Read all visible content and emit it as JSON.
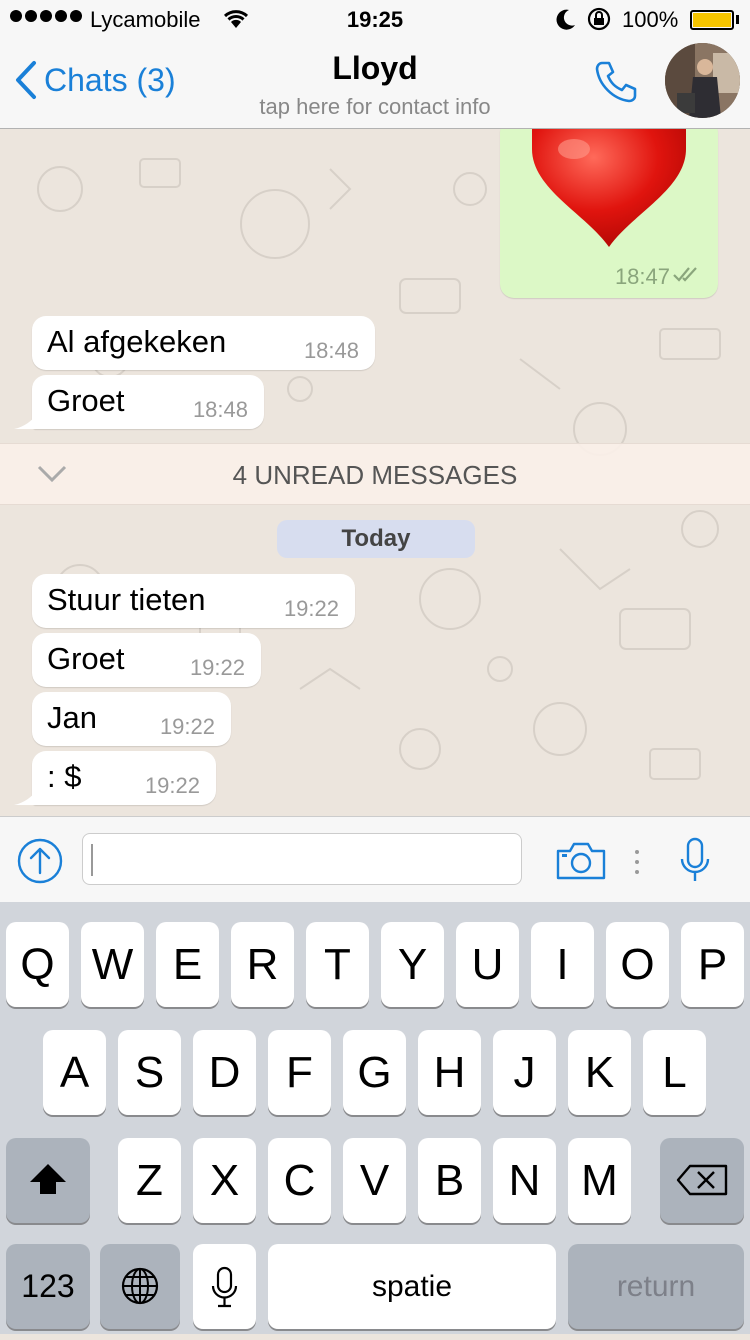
{
  "status_bar": {
    "carrier": "Lycamobile",
    "time": "19:25",
    "battery_percent": "100%",
    "battery_level": 1.0,
    "battery_color": "#f5c400"
  },
  "nav": {
    "back_label": "Chats (3)",
    "title": "Lloyd",
    "subtitle": "tap here for contact info",
    "accent_color": "#1a80d8",
    "icons": [
      "chevron-left-icon",
      "phone-icon",
      "avatar"
    ]
  },
  "chat": {
    "outgoing": {
      "content": "heart-emoji",
      "time": "18:47",
      "status": "read"
    },
    "messages_before": [
      {
        "text": "Al afgekeken",
        "time": "18:48"
      },
      {
        "text": "Groet",
        "time": "18:48"
      }
    ],
    "unread_banner": "4 UNREAD MESSAGES",
    "date_divider": "Today",
    "messages_after": [
      {
        "text": "Stuur tieten",
        "time": "19:22"
      },
      {
        "text": "Groet",
        "time": "19:22"
      },
      {
        "text": "Jan",
        "time": "19:22"
      },
      {
        "text": ": $",
        "time": "19:22"
      }
    ]
  },
  "input_bar": {
    "value": "",
    "icons": [
      "upload-icon",
      "camera-icon",
      "more-icon",
      "microphone-icon"
    ]
  },
  "keyboard": {
    "row1": [
      "Q",
      "W",
      "E",
      "R",
      "T",
      "Y",
      "U",
      "I",
      "O",
      "P"
    ],
    "row2": [
      "A",
      "S",
      "D",
      "F",
      "G",
      "H",
      "J",
      "K",
      "L"
    ],
    "row3": [
      "Z",
      "X",
      "C",
      "V",
      "B",
      "N",
      "M"
    ],
    "numbers_key": "123",
    "space_key": "spatie",
    "return_key": "return"
  }
}
